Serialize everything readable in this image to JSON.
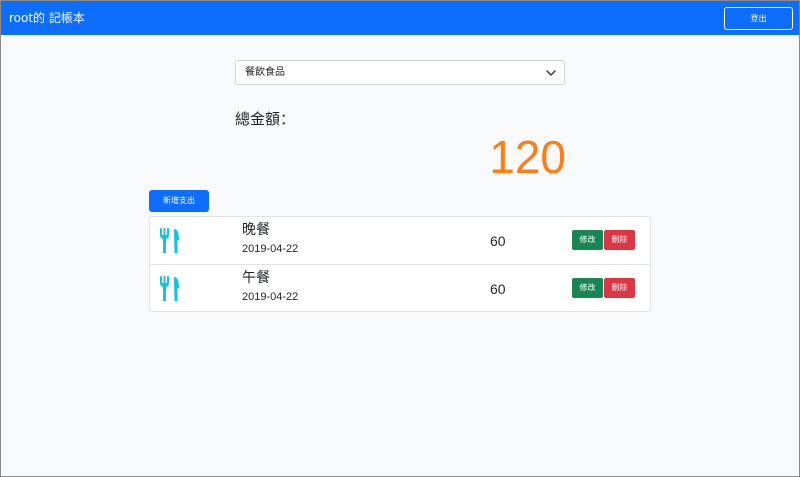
{
  "navbar": {
    "brand": "root的 記帳本",
    "logout_label": "登出",
    "color": "#0d6efd"
  },
  "filter": {
    "selected_category": "餐飲食品"
  },
  "summary": {
    "total_label": "總金額：",
    "total_value": "120",
    "total_color": "#fd7e14"
  },
  "actions": {
    "add_label": "新增支出"
  },
  "records": [
    {
      "icon": "utensils-icon",
      "name": "晚餐",
      "date": "2019-04-22",
      "amount": "60",
      "edit_label": "修改",
      "delete_label": "刪除"
    },
    {
      "icon": "utensils-icon",
      "name": "午餐",
      "date": "2019-04-22",
      "amount": "60",
      "edit_label": "修改",
      "delete_label": "刪除"
    }
  ],
  "colors": {
    "icon": "#17c0e0",
    "edit": "#198754",
    "delete": "#dc3545"
  }
}
